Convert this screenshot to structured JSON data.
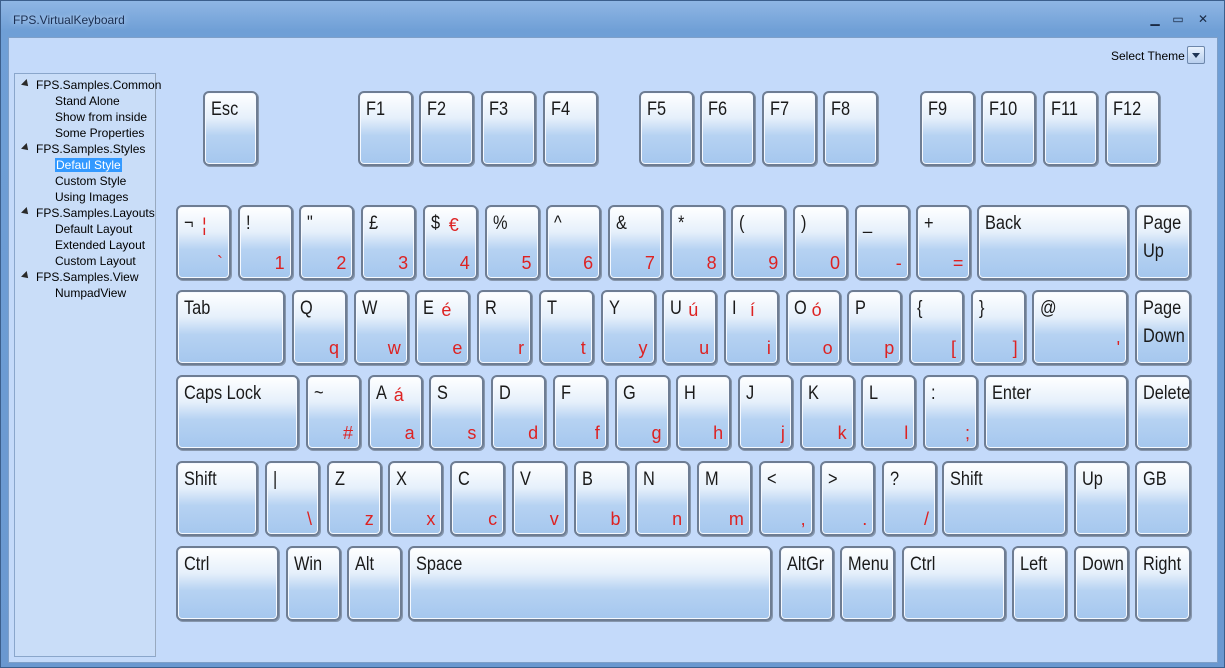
{
  "window": {
    "title": "FPS.VirtualKeyboard",
    "minimize": "▁",
    "maximize": "▭",
    "close": "✕"
  },
  "theme": {
    "label": "Select Theme"
  },
  "tree": [
    {
      "label": "FPS.Samples.Common",
      "level": 0
    },
    {
      "label": "Stand Alone",
      "level": 1
    },
    {
      "label": "Show from inside",
      "level": 1
    },
    {
      "label": "Some Properties",
      "level": 1
    },
    {
      "label": "FPS.Samples.Styles",
      "level": 0
    },
    {
      "label": "Defaul Style",
      "level": 1,
      "selected": true
    },
    {
      "label": "Custom Style",
      "level": 1
    },
    {
      "label": "Using Images",
      "level": 1
    },
    {
      "label": "FPS.Samples.Layouts",
      "level": 0
    },
    {
      "label": "Default Layout",
      "level": 1
    },
    {
      "label": "Extended Layout",
      "level": 1
    },
    {
      "label": "Custom Layout",
      "level": 1
    },
    {
      "label": "FPS.Samples.View",
      "level": 0
    },
    {
      "label": "NumpadView",
      "level": 1
    }
  ],
  "keyboard": {
    "function_row": [
      "Esc",
      "F1",
      "F2",
      "F3",
      "F4",
      "F5",
      "F6",
      "F7",
      "F8",
      "F9",
      "F10",
      "F11",
      "F12"
    ],
    "number_row": [
      {
        "main": "¬",
        "alt": "¦",
        "sub": "`"
      },
      {
        "main": "!",
        "sub": "1"
      },
      {
        "main": "\"",
        "sub": "2"
      },
      {
        "main": "£",
        "sub": "3"
      },
      {
        "main": "$",
        "alt": "€",
        "sub": "4"
      },
      {
        "main": "%",
        "sub": "5"
      },
      {
        "main": "^",
        "sub": "6"
      },
      {
        "main": "&",
        "sub": "7"
      },
      {
        "main": "*",
        "sub": "8"
      },
      {
        "main": "(",
        "sub": "9"
      },
      {
        "main": ")",
        "sub": "0"
      },
      {
        "main": "_",
        "sub": "-"
      },
      {
        "main": "+",
        "sub": "="
      },
      {
        "main": "Back"
      },
      {
        "main": "Page",
        "main2": "Up"
      }
    ],
    "qwerty_row": [
      {
        "main": "Tab"
      },
      {
        "main": "Q",
        "sub": "q"
      },
      {
        "main": "W",
        "sub": "w"
      },
      {
        "main": "E",
        "alt": "é",
        "sub": "e"
      },
      {
        "main": "R",
        "sub": "r"
      },
      {
        "main": "T",
        "sub": "t"
      },
      {
        "main": "Y",
        "sub": "y"
      },
      {
        "main": "U",
        "alt": "ú",
        "sub": "u"
      },
      {
        "main": "I",
        "alt": "í",
        "sub": "i"
      },
      {
        "main": "O",
        "alt": "ó",
        "sub": "o"
      },
      {
        "main": "P",
        "sub": "p"
      },
      {
        "main": "{",
        "sub": "["
      },
      {
        "main": "}",
        "sub": "]"
      },
      {
        "main": "@",
        "sub": "'"
      },
      {
        "main": "Page",
        "main2": "Down"
      }
    ],
    "home_row": [
      {
        "main": "Caps Lock"
      },
      {
        "main": "~",
        "sub": "#"
      },
      {
        "main": "A",
        "alt": "á",
        "sub": "a"
      },
      {
        "main": "S",
        "sub": "s"
      },
      {
        "main": "D",
        "sub": "d"
      },
      {
        "main": "F",
        "sub": "f"
      },
      {
        "main": "G",
        "sub": "g"
      },
      {
        "main": "H",
        "sub": "h"
      },
      {
        "main": "J",
        "sub": "j"
      },
      {
        "main": "K",
        "sub": "k"
      },
      {
        "main": "L",
        "sub": "l"
      },
      {
        "main": ":",
        "sub": ";"
      },
      {
        "main": "Enter"
      },
      {
        "main": "Delete"
      }
    ],
    "shift_row": [
      {
        "main": "Shift"
      },
      {
        "main": "|",
        "sub": "\\"
      },
      {
        "main": "Z",
        "sub": "z"
      },
      {
        "main": "X",
        "sub": "x"
      },
      {
        "main": "C",
        "sub": "c"
      },
      {
        "main": "V",
        "sub": "v"
      },
      {
        "main": "B",
        "sub": "b"
      },
      {
        "main": "N",
        "sub": "n"
      },
      {
        "main": "M",
        "sub": "m"
      },
      {
        "main": "<",
        "sub": ","
      },
      {
        "main": ">",
        "sub": "."
      },
      {
        "main": "?",
        "sub": "/"
      },
      {
        "main": "Shift"
      },
      {
        "main": "Up"
      },
      {
        "main": "GB"
      }
    ],
    "bottom_row": [
      {
        "main": "Ctrl"
      },
      {
        "main": "Win"
      },
      {
        "main": "Alt"
      },
      {
        "main": "Space"
      },
      {
        "main": "AltGr"
      },
      {
        "main": "Menu"
      },
      {
        "main": "Ctrl"
      },
      {
        "main": "Left"
      },
      {
        "main": "Down"
      },
      {
        "main": "Right"
      }
    ]
  }
}
